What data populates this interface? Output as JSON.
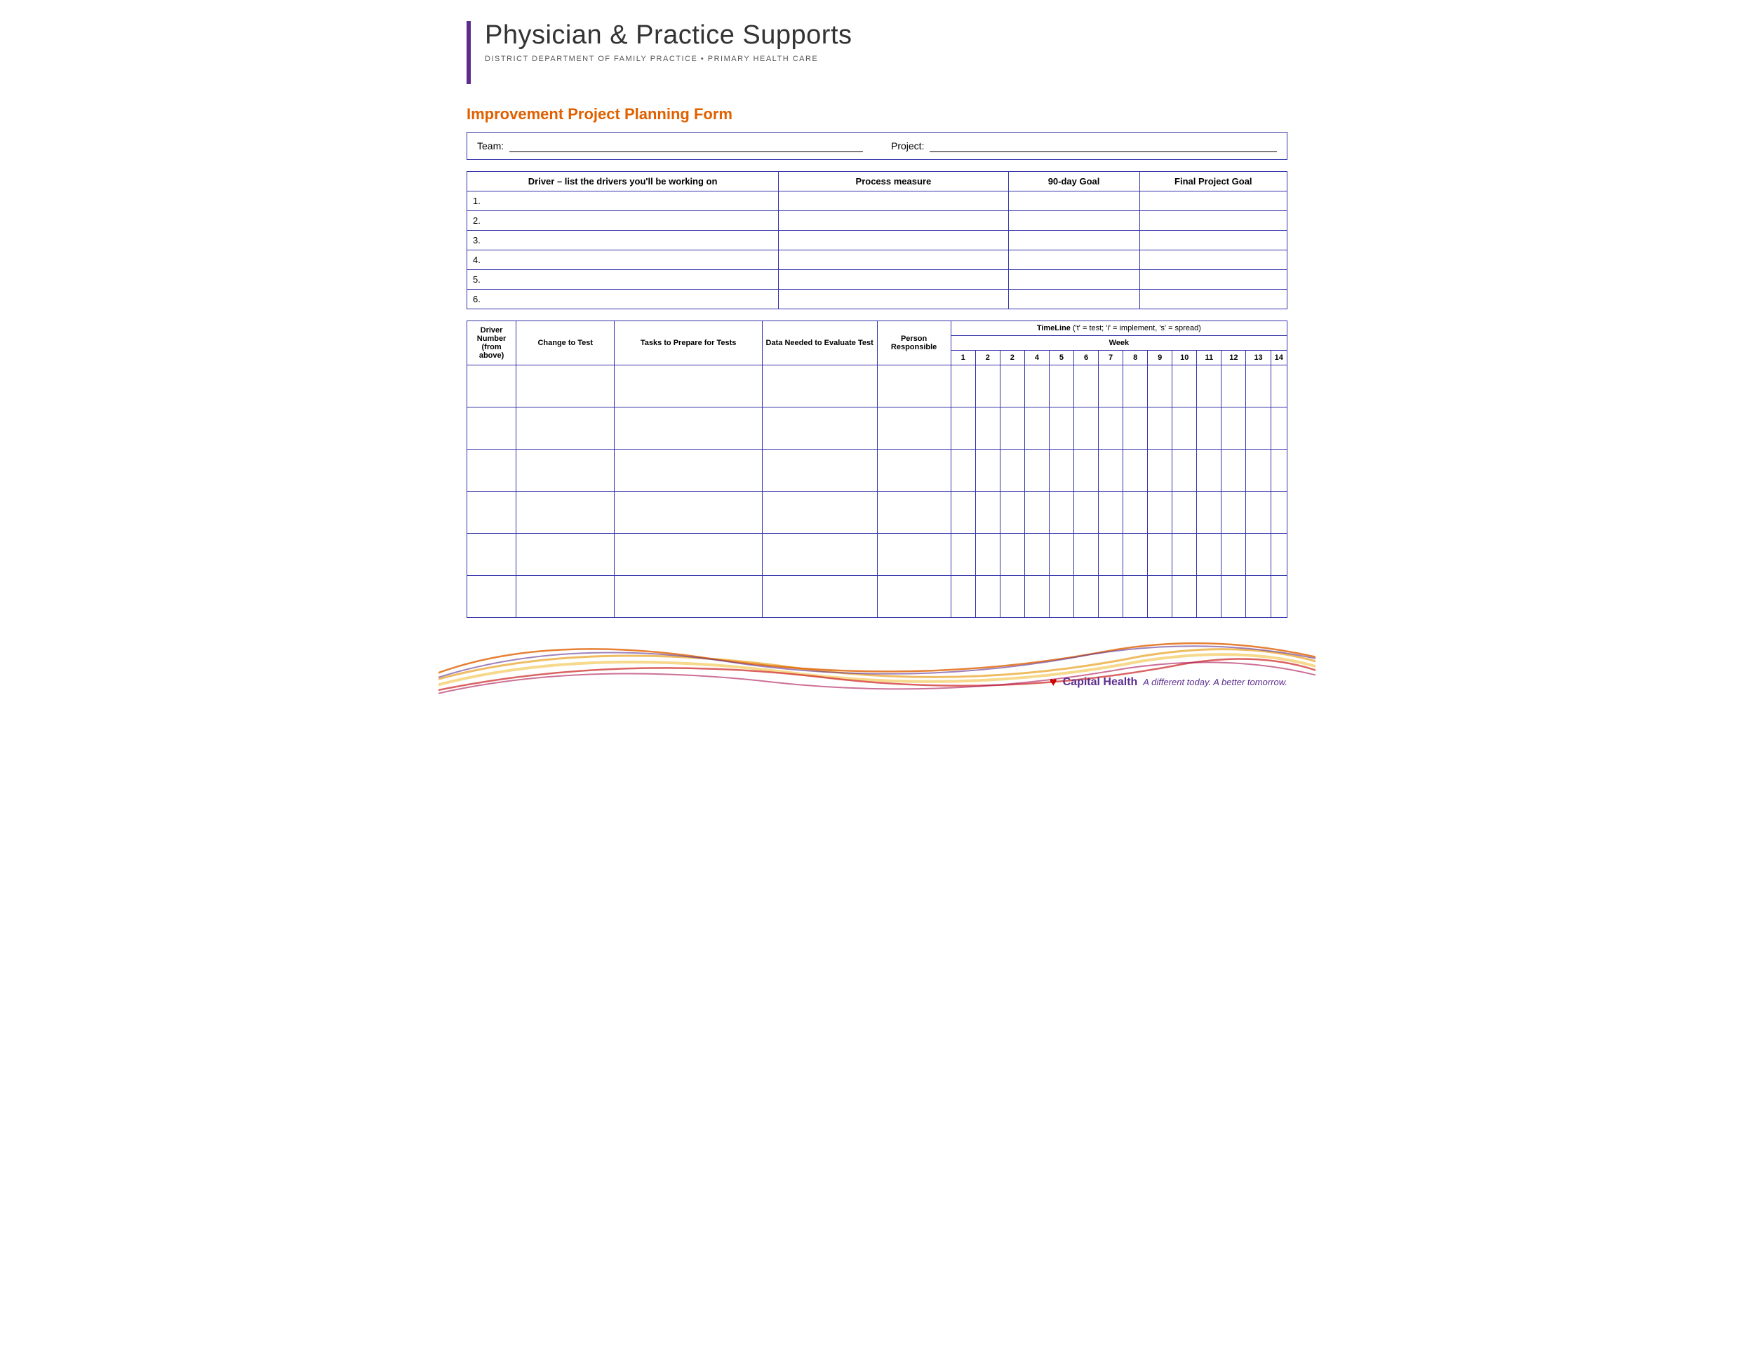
{
  "header": {
    "bar_color": "#5b2d8e",
    "title": "Physician & Practice Supports",
    "subtitle": "DISTRICT DEPARTMENT OF FAMILY PRACTICE  •  PRIMARY HEALTH CARE"
  },
  "form": {
    "title": "Improvement Project Planning Form",
    "team_label": "Team:",
    "project_label": "Project:"
  },
  "upper_table": {
    "headers": [
      "Driver – list the drivers you'll be working on",
      "Process measure",
      "90-day Goal",
      "Final Project Goal"
    ],
    "rows": [
      "1.",
      "2.",
      "3.",
      "4.",
      "5.",
      "6."
    ]
  },
  "lower_table": {
    "header_col1": "Driver Number (from above)",
    "header_col2": "Change to Test",
    "header_col3": "Tasks to Prepare for Tests",
    "header_col4": "Data Needed to Evaluate Test",
    "header_col5": "Person Responsible",
    "timeline_label": "TimeLine",
    "timeline_note": "('t' = test; 'i' = implement, 's' = spread)",
    "week_label": "Week",
    "week_numbers": [
      "1",
      "2",
      "2",
      "4",
      "5",
      "6",
      "7",
      "8",
      "9",
      "10",
      "11",
      "12",
      "13",
      "14"
    ],
    "data_rows": 6
  },
  "footer": {
    "capital_health": "Capital Health",
    "tagline": "A different today. A better tomorrow."
  }
}
